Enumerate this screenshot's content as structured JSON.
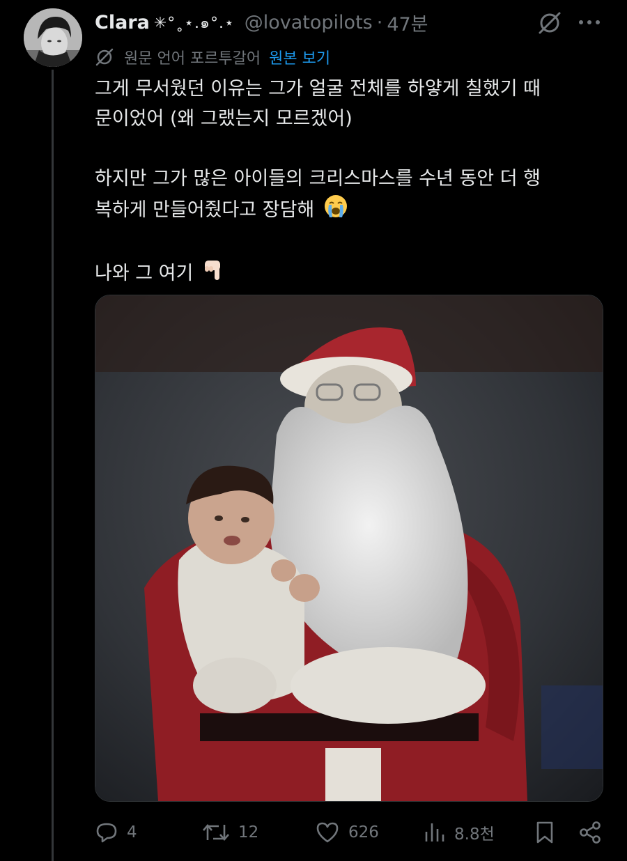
{
  "tweet": {
    "author": {
      "name": "Clara",
      "decoration": "✳°˳⋆.๑°.⋆",
      "handle": "@lovatopilots",
      "separator": "·",
      "time": "47분"
    },
    "translation": {
      "label": "원문 언어 포르투갈어",
      "link": "원본 보기"
    },
    "text": {
      "line1": "그게 무서웠던 이유는 그가 얼굴 전체를 하얗게 칠했기 때",
      "line2": "문이었어 (왜 그랬는지 모르겠어)",
      "line3": "하지만 그가 많은 아이들의 크리스마스를 수년 동안 더 행",
      "line4": "복하게 만들어줬다고 장담해",
      "line5": "나와 그 여기"
    },
    "emojis": {
      "crying": "loudly-crying-face",
      "pointing": "backhand-index-pointing-down"
    },
    "metrics": {
      "replies": "4",
      "reposts": "12",
      "likes": "626",
      "views": "8.8천"
    }
  },
  "colors": {
    "text": "#e7e9ea",
    "muted": "#71767b",
    "link": "#1d9bf0",
    "background": "#000000"
  }
}
